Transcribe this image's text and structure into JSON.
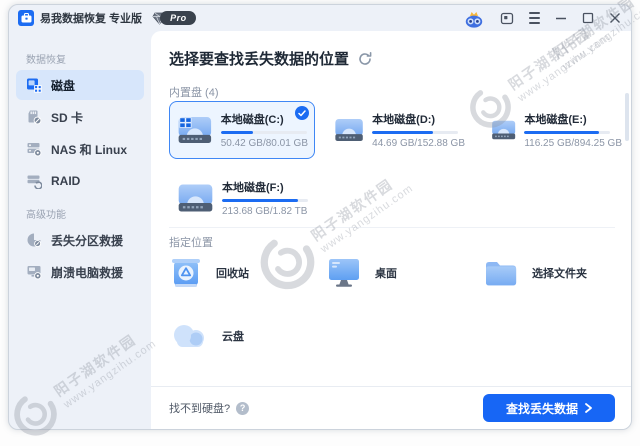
{
  "titlebar": {
    "app_title": "易我数据恢复 专业版",
    "pro_badge": "Pro"
  },
  "sidebar": {
    "sections": [
      {
        "label": "数据恢复",
        "items": [
          {
            "label": "磁盘",
            "icon": "disk-icon",
            "active": true
          },
          {
            "label": "SD 卡",
            "icon": "sd-card-icon",
            "active": false
          },
          {
            "label": "NAS 和 Linux",
            "icon": "nas-icon",
            "active": false
          },
          {
            "label": "RAID",
            "icon": "raid-icon",
            "active": false
          }
        ]
      },
      {
        "label": "高级功能",
        "items": [
          {
            "label": "丢失分区救援",
            "icon": "lost-partition-icon",
            "active": false
          },
          {
            "label": "崩溃电脑救援",
            "icon": "crashed-pc-icon",
            "active": false
          }
        ]
      }
    ]
  },
  "main": {
    "title": "选择要查找丢失数据的位置",
    "internal": {
      "label": "内置盘 (4)",
      "disks": [
        {
          "name": "本地磁盘(C:)",
          "size": "50.42 GB/80.01 GB",
          "used_percent": 37,
          "selected": true
        },
        {
          "name": "本地磁盘(D:)",
          "size": "44.69 GB/152.88 GB",
          "used_percent": 71,
          "selected": false
        },
        {
          "name": "本地磁盘(E:)",
          "size": "116.25 GB/894.25 GB",
          "used_percent": 87,
          "selected": false
        },
        {
          "name": "本地磁盘(F:)",
          "size": "213.68 GB/1.82 TB",
          "used_percent": 88,
          "selected": false
        }
      ]
    },
    "specified": {
      "label": "指定位置",
      "items": [
        {
          "label": "回收站",
          "icon": "recycle-bin-icon"
        },
        {
          "label": "桌面",
          "icon": "desktop-icon"
        },
        {
          "label": "选择文件夹",
          "icon": "folder-icon"
        },
        {
          "label": "云盘",
          "icon": "cloud-icon"
        }
      ]
    },
    "footer": {
      "help_text": "找不到硬盘?",
      "scan_button": "查找丢失数据"
    }
  },
  "watermark": {
    "line1": "阳子湖软件园",
    "line2": "www.yangzihu.com"
  },
  "colors": {
    "accent": "#1c6cf2",
    "selected_border": "#3f87f5",
    "bar_track": "#e7ebf2",
    "sidebar_active_bg": "#d7e6fb"
  }
}
